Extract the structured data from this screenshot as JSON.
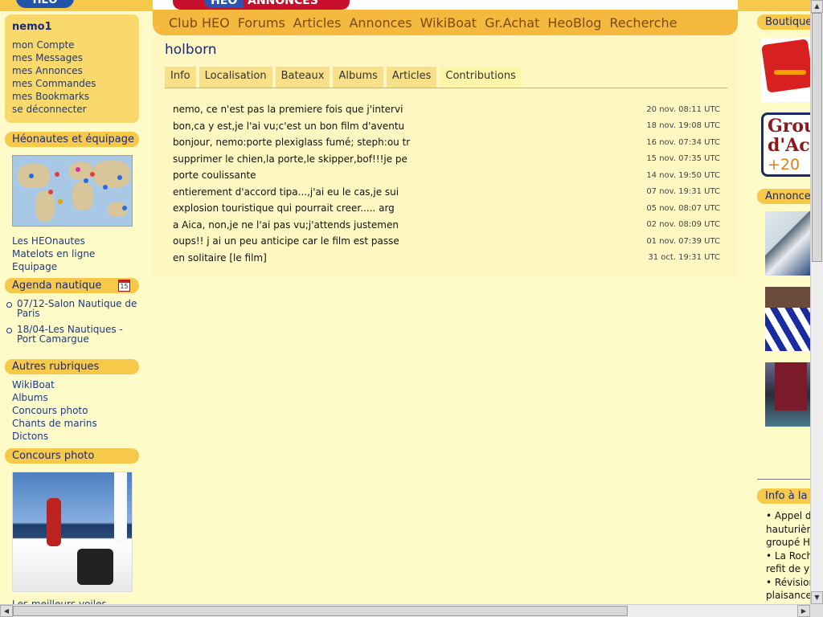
{
  "header": {
    "logo": "HEO",
    "annonces_logo": {
      "part1": "HEO",
      "part2": "ANNONCES"
    },
    "nav": [
      "Club HEO",
      "Forums",
      "Articles",
      "Annonces",
      "WikiBoat",
      "Gr.Achat",
      "HeoBlog",
      "Recherche"
    ]
  },
  "user": {
    "name": "nemo1",
    "links": [
      "mon Compte",
      "mes Messages",
      "mes Annonces",
      "mes Commandes",
      "mes Bookmarks",
      "se déconnecter"
    ]
  },
  "sections": {
    "heonautes": "Héonautes et équipage",
    "heonautes_links": [
      "Les HEOnautes",
      "Matelots en ligne",
      "Equipage"
    ],
    "agenda": "Agenda nautique",
    "agenda_icon_day": "15",
    "agenda_items": [
      "07/12-Salon Nautique de Paris",
      "18/04-Les Nautiques - Port Camargue"
    ],
    "autres": "Autres rubriques",
    "autres_links": [
      "WikiBoat",
      "Albums",
      "Concours photo",
      "Chants de marins",
      "Dictons"
    ],
    "concours": "Concours photo",
    "bottom_cut_text": "Les meilleurs voiles"
  },
  "main": {
    "title": "holborn",
    "tabs": [
      "Info",
      "Localisation",
      "Bateaux",
      "Albums",
      "Articles",
      "Contributions"
    ],
    "active_tab": "Contributions",
    "contributions": [
      {
        "text": "nemo, ce n'est pas la premiere fois que j'intervi",
        "date": "20 nov. 08:11 UTC"
      },
      {
        "text": "bon,ca y est,je l'ai vu;c'est un bon film d'aventu",
        "date": "18 nov. 19:08 UTC"
      },
      {
        "text": "bonjour, nemo:porte plexiglass fumé; steph:ou tr",
        "date": "16 nov. 07:34 UTC"
      },
      {
        "text": "supprimer le chien,la porte,le skipper,bof!!!je pe",
        "date": "15 nov. 07:35 UTC"
      },
      {
        "text": "porte coulissante",
        "date": "14 nov. 19:50 UTC"
      },
      {
        "text": "entierement d'accord tipa...,j'ai eu le cas,je sui",
        "date": "07 nov. 19:31 UTC"
      },
      {
        "text": "explosion touristique qui pourrait creer..... arg",
        "date": "05 nov. 08:07 UTC"
      },
      {
        "text": "a Aica, non,je ne l'ai pas vu;j'attends justemen",
        "date": "02 nov. 08:09 UTC"
      },
      {
        "text": "oups!! j ai un peu anticipe car le film est passe",
        "date": "01 nov. 07:39 UTC"
      },
      {
        "text": "en solitaire [le film]",
        "date": "31 oct. 19:31 UTC"
      }
    ]
  },
  "right": {
    "boutique": "Boutique",
    "group": {
      "line1": "Grou",
      "line2": "d'Ac",
      "line3": "+20"
    },
    "annonces": "Annonce",
    "info": "Info à la",
    "info_lines": [
      "• Appel d",
      "hauturière",
      "groupé HE",
      "• La Roch",
      "refit de y",
      "• Révision",
      "plaisance"
    ]
  }
}
